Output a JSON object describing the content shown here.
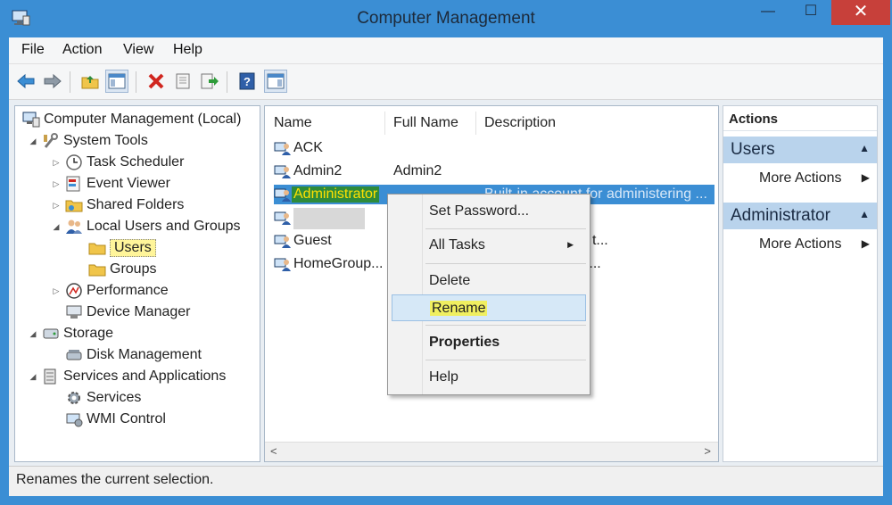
{
  "window": {
    "title": "Computer Management",
    "minimize": "—",
    "maximize": "☐",
    "close": "✕"
  },
  "menu": {
    "file": "File",
    "action": "Action",
    "view": "View",
    "help": "Help"
  },
  "toolbar": {
    "buttons": [
      "back-arrow-icon",
      "forward-arrow-icon",
      "up-folder-icon",
      "show-hide-tree-icon",
      "delete-icon",
      "properties-icon",
      "export-list-icon",
      "help-icon",
      "show-hide-action-pane-icon"
    ]
  },
  "tree": {
    "root": "Computer Management (Local)",
    "system_tools": "System Tools",
    "task_scheduler": "Task Scheduler",
    "event_viewer": "Event Viewer",
    "shared_folders": "Shared Folders",
    "local_users_groups": "Local Users and Groups",
    "users": "Users",
    "groups": "Groups",
    "performance": "Performance",
    "device_manager": "Device Manager",
    "storage": "Storage",
    "disk_management": "Disk Management",
    "services_apps": "Services and Applications",
    "services": "Services",
    "wmi": "WMI Control"
  },
  "list": {
    "headers": {
      "name": "Name",
      "full_name": "Full Name",
      "description": "Description"
    },
    "rows": [
      {
        "name": "ACK",
        "full_name": "",
        "description": ""
      },
      {
        "name": "Admin2",
        "full_name": "Admin2",
        "description": ""
      },
      {
        "name": "Administrator",
        "full_name": "",
        "description": "Built-in account for administering ..."
      },
      {
        "name": "",
        "full_name": "",
        "description": ""
      },
      {
        "name": "Guest",
        "full_name": "",
        "description": "for guest access t..."
      },
      {
        "name": "HomeGroup...",
        "full_name": "",
        "description": "for homegroup a..."
      }
    ],
    "scroll_left": "<",
    "scroll_right": ">"
  },
  "actions": {
    "header": "Actions",
    "section1": "Users",
    "section1_more": "More Actions",
    "section2": "Administrator",
    "section2_more": "More Actions",
    "collapse": "▲",
    "more_arrow": "▶"
  },
  "context_menu": {
    "set_password": "Set Password...",
    "all_tasks": "All Tasks",
    "delete": "Delete",
    "rename": "Rename",
    "properties": "Properties",
    "help": "Help",
    "submenu_arrow": "▶"
  },
  "status": {
    "text": "Renames the current selection."
  },
  "colors": {
    "titlebar": "#3b8ed4",
    "close": "#c7403a",
    "selection": "#3b8ed4",
    "highlight": "#f0ef60"
  }
}
